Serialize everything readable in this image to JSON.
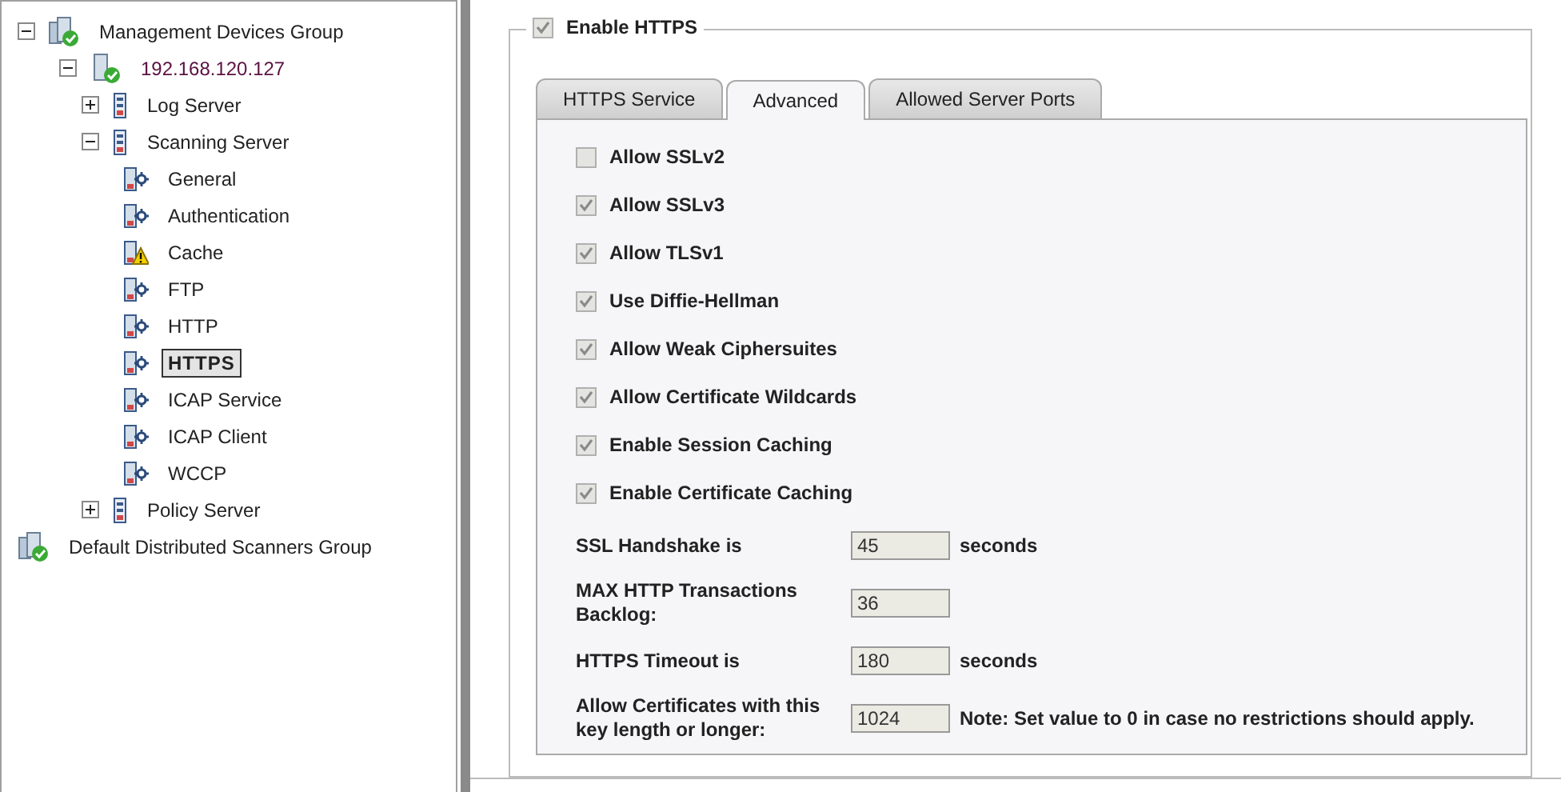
{
  "tree": [
    {
      "label": "Management Devices Group",
      "kind": "group",
      "expanded": true,
      "selected": false,
      "children": [
        {
          "label": "192.168.120.127",
          "kind": "host",
          "expanded": true,
          "selected": false,
          "children": [
            {
              "label": "Log Server",
              "kind": "server",
              "expanded": false,
              "selected": false
            },
            {
              "label": "Scanning Server",
              "kind": "server",
              "expanded": true,
              "selected": false,
              "children": [
                {
                  "label": "General",
                  "kind": "module",
                  "selected": false
                },
                {
                  "label": "Authentication",
                  "kind": "module",
                  "selected": false
                },
                {
                  "label": "Cache",
                  "kind": "warning",
                  "selected": false
                },
                {
                  "label": "FTP",
                  "kind": "module",
                  "selected": false
                },
                {
                  "label": "HTTP",
                  "kind": "module",
                  "selected": false
                },
                {
                  "label": "HTTPS",
                  "kind": "module",
                  "selected": true
                },
                {
                  "label": "ICAP Service",
                  "kind": "module",
                  "selected": false
                },
                {
                  "label": "ICAP Client",
                  "kind": "module",
                  "selected": false
                },
                {
                  "label": "WCCP",
                  "kind": "module",
                  "selected": false
                }
              ]
            },
            {
              "label": "Policy Server",
              "kind": "server",
              "expanded": false,
              "selected": false
            }
          ]
        }
      ]
    },
    {
      "label": "Default Distributed Scanners Group",
      "kind": "group",
      "selected": false
    }
  ],
  "enable": {
    "label": "Enable HTTPS",
    "checked": true
  },
  "tabs": [
    {
      "label": "HTTPS Service",
      "selected": false
    },
    {
      "label": "Advanced",
      "selected": true
    },
    {
      "label": "Allowed Server Ports",
      "selected": false
    }
  ],
  "options": [
    {
      "label": "Allow SSLv2",
      "checked": false
    },
    {
      "label": "Allow SSLv3",
      "checked": true
    },
    {
      "label": "Allow TLSv1",
      "checked": true
    },
    {
      "label": "Use Diffie-Hellman",
      "checked": true
    },
    {
      "label": "Allow Weak Ciphersuites",
      "checked": true
    },
    {
      "label": "Allow Certificate Wildcards",
      "checked": true
    },
    {
      "label": "Enable Session Caching",
      "checked": true
    },
    {
      "label": "Enable Certificate Caching",
      "checked": true
    }
  ],
  "fields": [
    {
      "label": "SSL Handshake is",
      "value": "45",
      "suffix": "seconds"
    },
    {
      "label": "MAX HTTP Transactions Backlog:",
      "value": "36"
    },
    {
      "label": "HTTPS Timeout is",
      "value": "180",
      "suffix": "seconds"
    },
    {
      "label": "Allow Certificates with this key length or longer:",
      "value": "1024",
      "suffix": "Note: Set value to 0 in case no restrictions should apply."
    }
  ]
}
